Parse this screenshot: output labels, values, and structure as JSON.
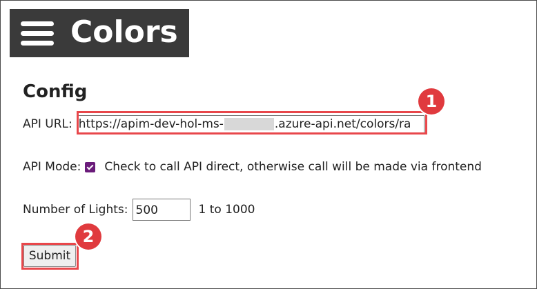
{
  "header": {
    "menu_icon": "hamburger-menu-icon",
    "title": "Colors",
    "background": "#3a3a3a"
  },
  "config": {
    "title": "Config",
    "api_url": {
      "label": "API URL:",
      "value_prefix": "https://apim-dev-hol-ms-",
      "value_suffix": ".azure-api.net/colors/ra"
    },
    "api_mode": {
      "label": "API Mode:",
      "checked": true,
      "description": "Check to call API direct, otherwise call will be made via frontend"
    },
    "lights": {
      "label": "Number of Lights:",
      "value": "500",
      "range": "1 to 1000"
    },
    "submit_label": "Submit"
  },
  "annotations": {
    "badge_1": "1",
    "badge_2": "2",
    "color": "#e03a3e"
  }
}
